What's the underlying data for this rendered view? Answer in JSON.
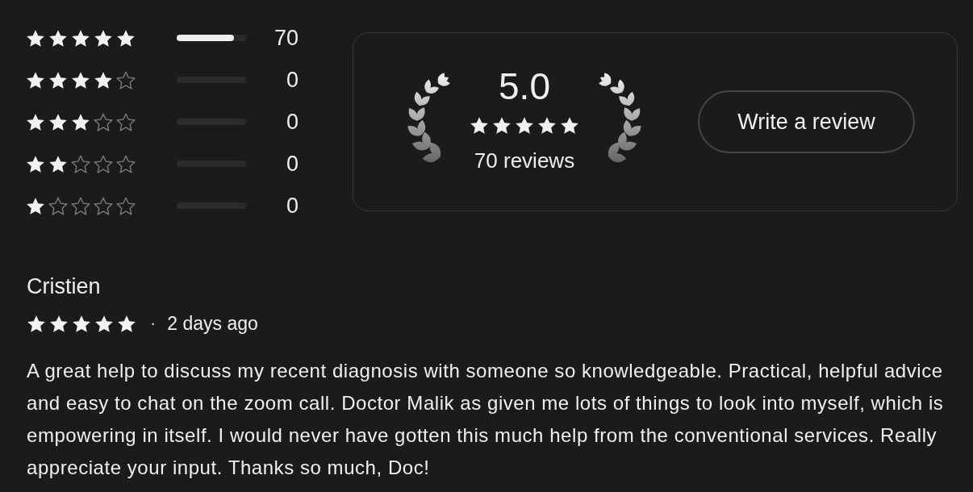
{
  "rating_breakdown": [
    {
      "stars": 5,
      "level": 0.83,
      "count": "70"
    },
    {
      "stars": 4,
      "level": 0,
      "count": "0"
    },
    {
      "stars": 3,
      "level": 0,
      "count": "0"
    },
    {
      "stars": 2,
      "level": 0,
      "count": "0"
    },
    {
      "stars": 1,
      "level": 0,
      "count": "0"
    }
  ],
  "summary": {
    "average": "5.0",
    "stars": 5,
    "review_count": "70 reviews",
    "button": "Write a review"
  },
  "reviews": [
    {
      "author": "Cristien",
      "stars": 5,
      "separator": "·",
      "time": "2 days ago",
      "text": "A great help to discuss my recent diagnosis with someone so knowledgeable. Practical, helpful advice and easy to chat on the zoom call. Doctor Malik as given me lots of things to look into myself, which is empowering in itself. I would never have gotten this much help from the conventional services. Really appreciate your input. Thanks so much, Doc!"
    }
  ]
}
